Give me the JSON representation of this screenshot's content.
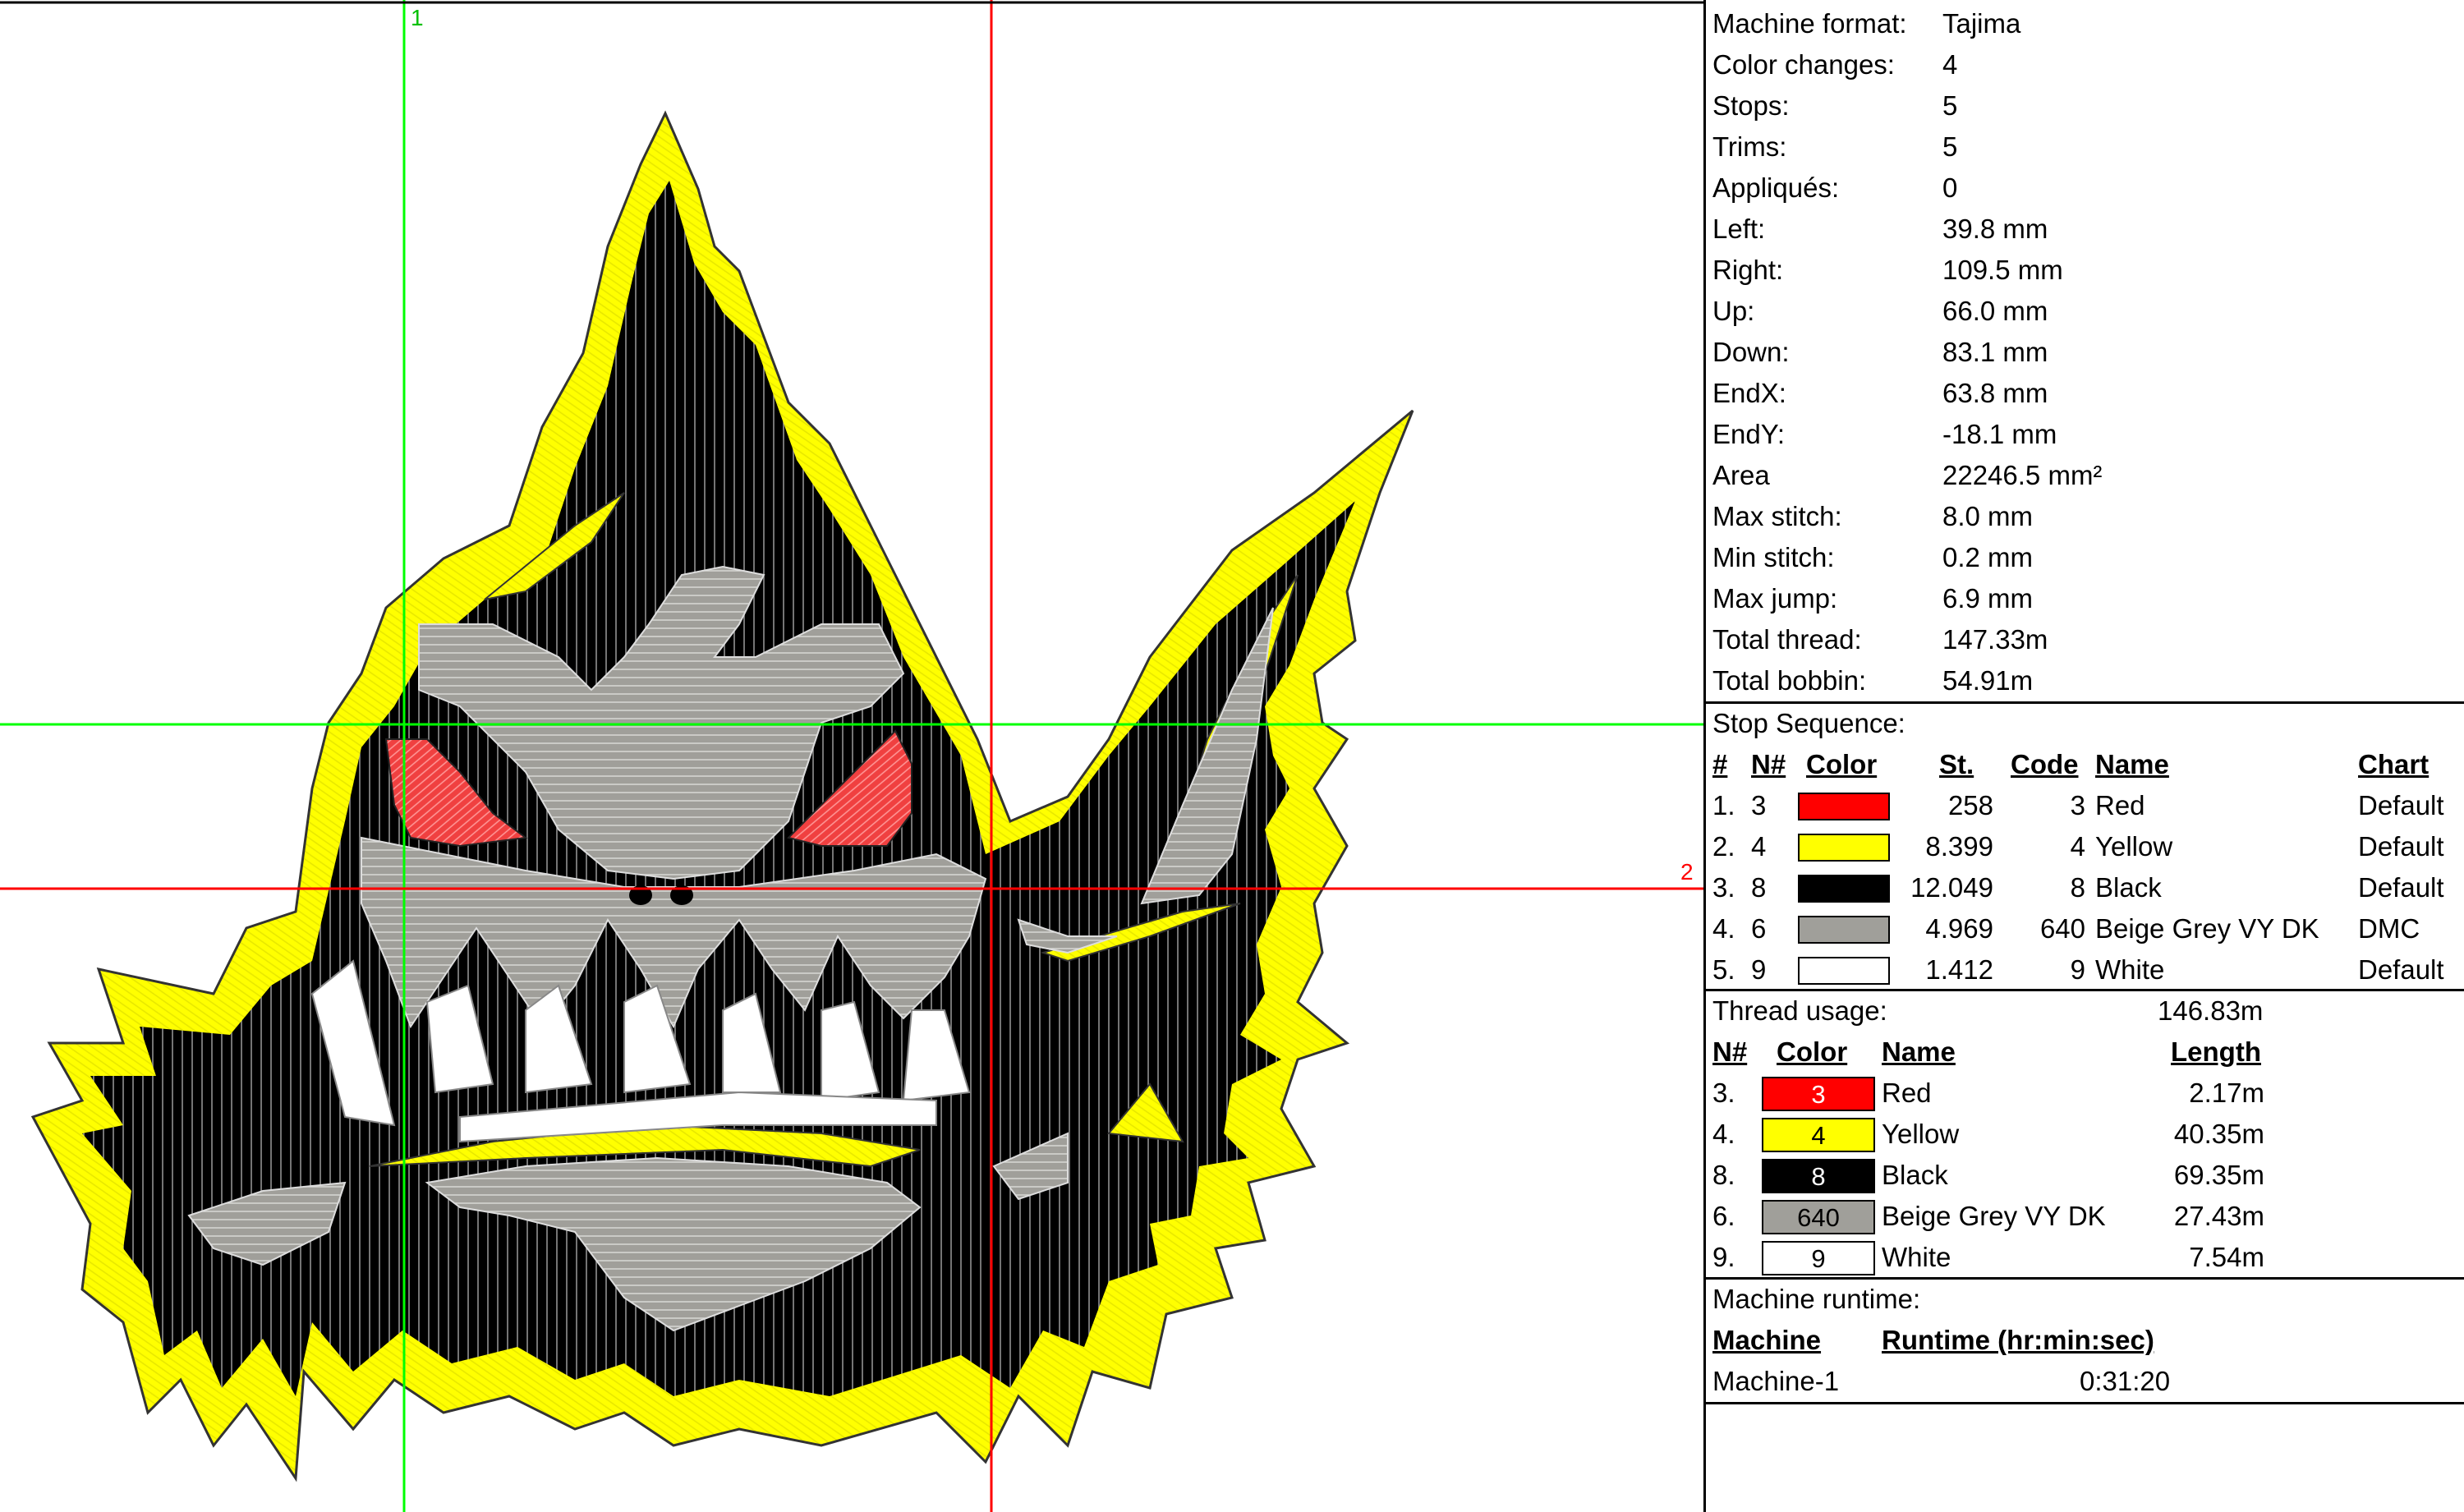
{
  "colors": {
    "red": "#ff0000",
    "yellow": "#ffff00",
    "black": "#000000",
    "grey": "#a09f9a",
    "white": "#ffffff",
    "guide_green": "#00ff00",
    "guide_red": "#ff0000"
  },
  "canvas": {
    "guide_1_label": "1",
    "guide_2_label": "2",
    "design_description_icon": "piranha-fish-embroidery"
  },
  "stats": [
    {
      "label": "Machine format:",
      "value": "Tajima"
    },
    {
      "label": "Color changes:",
      "value": "4"
    },
    {
      "label": "Stops:",
      "value": "5"
    },
    {
      "label": "Trims:",
      "value": "5"
    },
    {
      "label": "Appliqués:",
      "value": "0"
    },
    {
      "label": "Left:",
      "value": "39.8 mm"
    },
    {
      "label": "Right:",
      "value": "109.5 mm"
    },
    {
      "label": "Up:",
      "value": "66.0 mm"
    },
    {
      "label": "Down:",
      "value": "83.1 mm"
    },
    {
      "label": "EndX:",
      "value": "63.8 mm"
    },
    {
      "label": "EndY:",
      "value": "-18.1 mm"
    },
    {
      "label": "Area",
      "value": "22246.5 mm²"
    },
    {
      "label": "Max stitch:",
      "value": "8.0 mm"
    },
    {
      "label": "Min stitch:",
      "value": "0.2 mm"
    },
    {
      "label": "Max jump:",
      "value": "6.9 mm"
    },
    {
      "label": "Total thread:",
      "value": "147.33m"
    },
    {
      "label": "Total bobbin:",
      "value": "54.91m"
    }
  ],
  "stop_sequence": {
    "title": "Stop Sequence:",
    "headers": {
      "num": "#",
      "n": "N#",
      "color": "Color",
      "st": "St.",
      "code": "Code",
      "name": "Name",
      "chart": "Chart"
    },
    "rows": [
      {
        "num": "1.",
        "n": "3",
        "color": "#ff0000",
        "st": "258",
        "code": "3",
        "name": "Red",
        "chart": "Default"
      },
      {
        "num": "2.",
        "n": "4",
        "color": "#ffff00",
        "st": "8.399",
        "code": "4",
        "name": "Yellow",
        "chart": "Default"
      },
      {
        "num": "3.",
        "n": "8",
        "color": "#000000",
        "st": "12.049",
        "code": "8",
        "name": "Black",
        "chart": "Default"
      },
      {
        "num": "4.",
        "n": "6",
        "color": "#a09f9a",
        "st": "4.969",
        "code": "640",
        "name": "Beige Grey VY DK",
        "chart": "DMC"
      },
      {
        "num": "5.",
        "n": "9",
        "color": "#ffffff",
        "st": "1.412",
        "code": "9",
        "name": "White",
        "chart": "Default"
      }
    ]
  },
  "thread_usage": {
    "title": "Thread usage:",
    "total": "146.83m",
    "headers": {
      "n": "N#",
      "color": "Color",
      "name": "Name",
      "length": "Length"
    },
    "rows": [
      {
        "n": "3.",
        "color": "#ff0000",
        "text_color": "#ffffff",
        "code": "3",
        "name": "Red",
        "length": "2.17m"
      },
      {
        "n": "4.",
        "color": "#ffff00",
        "text_color": "#000000",
        "code": "4",
        "name": "Yellow",
        "length": "40.35m"
      },
      {
        "n": "8.",
        "color": "#000000",
        "text_color": "#ffffff",
        "code": "8",
        "name": "Black",
        "length": "69.35m"
      },
      {
        "n": "6.",
        "color": "#a09f9a",
        "text_color": "#000000",
        "code": "640",
        "name": "Beige Grey VY DK",
        "length": "27.43m"
      },
      {
        "n": "9.",
        "color": "#ffffff",
        "text_color": "#000000",
        "code": "9",
        "name": "White",
        "length": "7.54m"
      }
    ]
  },
  "runtime": {
    "title": "Machine runtime:",
    "headers": {
      "machine": "Machine",
      "runtime": "Runtime (hr:min:sec)"
    },
    "rows": [
      {
        "machine": "Machine-1",
        "runtime": "0:31:20"
      }
    ]
  }
}
